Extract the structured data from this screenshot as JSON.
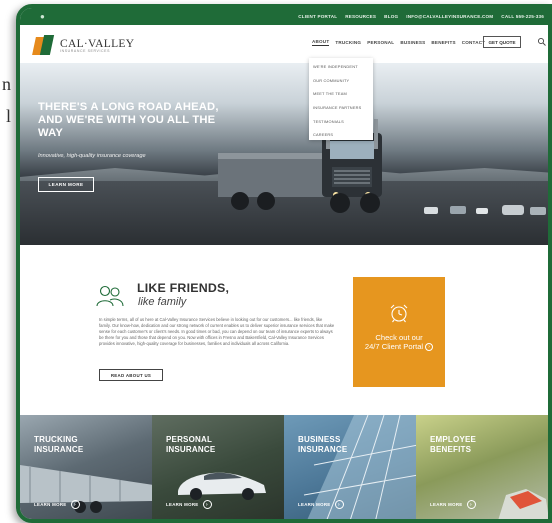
{
  "peek_left": [
    "n",
    "l"
  ],
  "topbar": {
    "links": [
      "CLIENT PORTAL",
      "RESOURCES",
      "BLOG",
      "INFO@CALVALLEYINSURANCE.COM",
      "CALL 559-225-336"
    ]
  },
  "logo": {
    "name": "CAL·VALLEY",
    "tagline": "INSURANCE SERVICES"
  },
  "nav": {
    "items": [
      "ABOUT",
      "TRUCKING",
      "PERSONAL",
      "BUSINESS",
      "BENEFITS",
      "CONTACT"
    ],
    "active": "ABOUT",
    "cta": "GET QUOTE"
  },
  "dropdown": {
    "items": [
      "WE'RE INDEPENDENT",
      "OUR COMMUNITY",
      "MEET THE TEAM",
      "INSURANCE PARTNERS",
      "TESTIMONIALS",
      "CAREERS"
    ]
  },
  "hero": {
    "title": "THERE'S A LONG ROAD AHEAD, AND WE'RE WITH YOU ALL THE WAY",
    "subtitle": "Innovative, high-quality insurance coverage",
    "button": "LEARN MORE"
  },
  "intro": {
    "title": "LIKE FRIENDS,",
    "subtitle": "like family",
    "body": "In simple terms, all of us here at Cal-Valley Insurance Services believe in looking out for our customers... like friends, like family. Our know-how, dedication and our strong network of current enables us to deliver superior insurance services that make sense for each customer's or client's needs. In good times or bad, you can depend on our team of insurance experts to always be there for you and those that depend on you. Now with offices in Fresno and Bakersfield, Cal-Valley Insurance Services provides innovative, high-quality coverage for businesses, families and individuals all across California.",
    "button": "READ ABOUT US"
  },
  "portal": {
    "line1": "Check out our",
    "line2": "24/7 Client Portal"
  },
  "tiles": [
    {
      "title_line1": "TRUCKING",
      "title_line2": "INSURANCE",
      "more": "LEARN MORE"
    },
    {
      "title_line1": "PERSONAL",
      "title_line2": "INSURANCE",
      "more": "LEARN MORE"
    },
    {
      "title_line1": "BUSINESS",
      "title_line2": "INSURANCE",
      "more": "LEARN MORE"
    },
    {
      "title_line1": "EMPLOYEE",
      "title_line2": "BENEFITS",
      "more": "LEARN MORE"
    }
  ],
  "colors": {
    "brand_green": "#1f6b38",
    "brand_orange": "#e6961f"
  }
}
